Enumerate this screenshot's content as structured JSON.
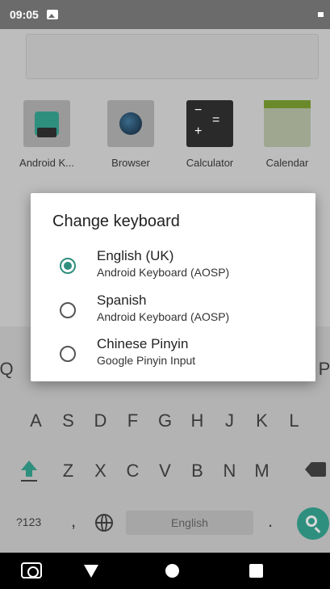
{
  "status_bar": {
    "time": "09:05"
  },
  "home": {
    "apps": [
      {
        "label": "Android K..."
      },
      {
        "label": "Browser"
      },
      {
        "label": "Calculator"
      },
      {
        "label": "Calendar"
      }
    ]
  },
  "keyboard": {
    "row2": [
      "A",
      "S",
      "D",
      "F",
      "G",
      "H",
      "J",
      "K",
      "L"
    ],
    "row3": [
      "Z",
      "X",
      "C",
      "V",
      "B",
      "N",
      "M"
    ],
    "left_partial": "Q",
    "right_partial": "P",
    "mode_label": "?123",
    "comma": ",",
    "space_label": "English",
    "period": ".",
    "accent_color": "#2f8f7f"
  },
  "dialog": {
    "title": "Change keyboard",
    "options": [
      {
        "name": "English (UK)",
        "source": "Android Keyboard (AOSP)",
        "selected": true
      },
      {
        "name": "Spanish",
        "source": "Android Keyboard (AOSP)",
        "selected": false
      },
      {
        "name": "Chinese Pinyin",
        "source": "Google Pinyin Input",
        "selected": false
      }
    ]
  }
}
